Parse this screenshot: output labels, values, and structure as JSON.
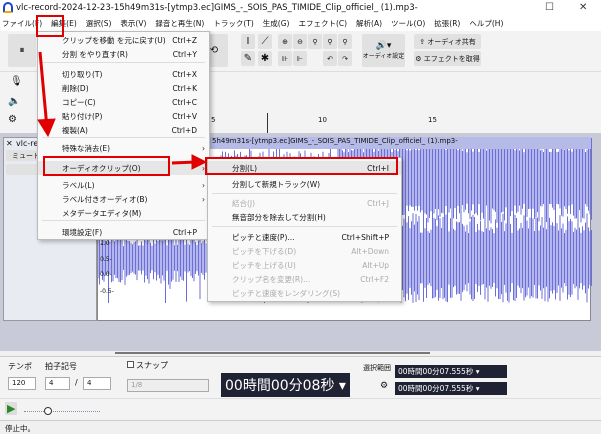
{
  "window": {
    "title": "vlc-record-2024-12-23-15h49m31s-[ytmp3.ec]GIMS_-_SOIS_PAS_TIMIDE_Clip_officiel_ (1).mp3-"
  },
  "menubar": [
    "ファイル(F)",
    "編集(E)",
    "選択(S)",
    "表示(V)",
    "録音と再生(N)",
    "トラック(T)",
    "生成(G)",
    "エフェクト(C)",
    "解析(A)",
    "ツール(O)",
    "拡張(R)",
    "ヘルプ(H)"
  ],
  "toolbar": {
    "audio_settings": "オーディオ設定",
    "share_audio": "オーディオ共有",
    "get_effects": "エフェクトを取得"
  },
  "ruler": [
    "5",
    "10",
    "15"
  ],
  "track": {
    "name": "vlc-re",
    "mute": "ミュート",
    "solo": "ソ",
    "clip_title": "5h49m31s-[ytmp3.ec]GIMS_-_SOIS_PAS_TIMIDE_Clip_officiel_ (1).mp3-",
    "scale": [
      "1.0",
      "0.5-",
      "0.0-",
      "-0.5-"
    ]
  },
  "edit_menu": [
    {
      "label": "クリップを移動 を元に戻す(U)",
      "shortcut": "Ctrl+Z"
    },
    {
      "label": "分割 をやり直す(R)",
      "shortcut": "Ctrl+Y"
    },
    {
      "label": "切り取り(T)",
      "shortcut": "Ctrl+X"
    },
    {
      "label": "削除(D)",
      "shortcut": "Ctrl+K"
    },
    {
      "label": "コピー(C)",
      "shortcut": "Ctrl+C"
    },
    {
      "label": "貼り付け(P)",
      "shortcut": "Ctrl+V"
    },
    {
      "label": "複製(A)",
      "shortcut": "Ctrl+D"
    },
    {
      "label": "特殊な消去(E)",
      "shortcut": ""
    },
    {
      "label": "オーディオクリップ(O)",
      "shortcut": ""
    },
    {
      "label": "ラベル(L)",
      "shortcut": ""
    },
    {
      "label": "ラベル付きオーディオ(B)",
      "shortcut": ""
    },
    {
      "label": "メタデータエディタ(M)",
      "shortcut": ""
    },
    {
      "label": "環境設定(F)",
      "shortcut": "Ctrl+P"
    }
  ],
  "clip_submenu": [
    {
      "label": "分割(L)",
      "shortcut": "Ctrl+I"
    },
    {
      "label": "分割して新規トラック(W)",
      "shortcut": ""
    },
    {
      "label": "結合(J)",
      "shortcut": "Ctrl+J"
    },
    {
      "label": "無音部分を除去して分割(H)",
      "shortcut": ""
    },
    {
      "label": "ピッチと速度(P)...",
      "shortcut": "Ctrl+Shift+P"
    },
    {
      "label": "ピッチを下げる(D)",
      "shortcut": "Alt+Down"
    },
    {
      "label": "ピッチを上げる(U)",
      "shortcut": "Alt+Up"
    },
    {
      "label": "クリップ名を変更(R)...",
      "shortcut": "Ctrl+F2"
    },
    {
      "label": "ピッチと速度をレンダリング(S)",
      "shortcut": ""
    }
  ],
  "bottom": {
    "tempo_label": "テンポ",
    "tempo": "120",
    "timesig_label": "拍子記号",
    "timesig_num": "4",
    "slash": "/",
    "timesig_den": "4",
    "snap_label": "スナップ",
    "snap_value": "1/8",
    "time": "00時間00分08秒",
    "selection_label": "選択範囲",
    "sel_start": "00時間00分07.555秒",
    "sel_end": "00時間00分07.555秒"
  },
  "status": "停止中。",
  "colors": {
    "wave": "#6b6fd9",
    "highlight": "#e00000",
    "timebg": "#1f2233"
  }
}
